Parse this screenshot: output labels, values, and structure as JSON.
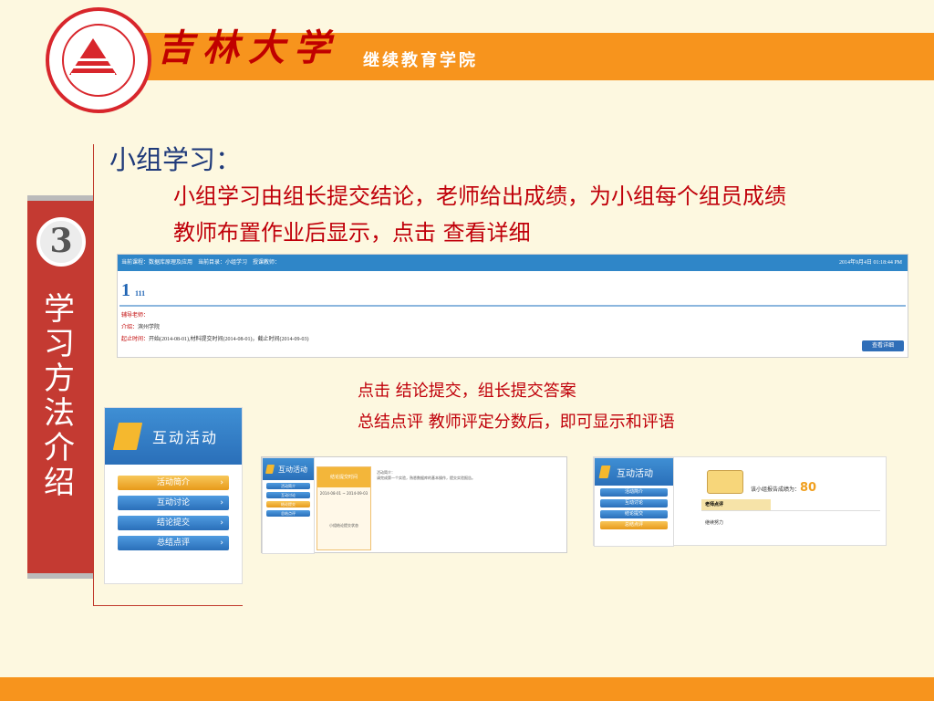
{
  "header": {
    "university": "吉林大学",
    "college": "继续教育学院"
  },
  "section": {
    "number": "3",
    "vertical_title": "学习方法介绍"
  },
  "content": {
    "title": "小组学习：",
    "desc_line1": "小组学习由组长提交结论，老师给出成绩，为小组每个组员成绩",
    "desc_line2": "教师布置作业后显示，点击 查看详细",
    "note_line1": "点击 结论提交，组长提交答案",
    "note_line2": "总结点评 教师评定分数后，即可显示和评语"
  },
  "screenshot_detail": {
    "breadcrumb": "当前课程：数据库原理及应用　当前目录：小组学习　授课教师：",
    "date": "2014年9月4日 01:18:44 PM",
    "title_num": "1",
    "title_sub": "111",
    "tutor_label": "辅导老师：",
    "intro_label": "介绍：",
    "intro_value": "滨州学院",
    "deadline_label": "起止时间：",
    "deadline_value": "开始(2014-08-01),材料提交时间(2014-08-01)，截止时间(2014-09-03)",
    "view_button": "查看详细"
  },
  "activity_panel": {
    "title": "互动活动",
    "items": [
      {
        "label": "活动简介",
        "active": true
      },
      {
        "label": "互动讨论",
        "active": false
      },
      {
        "label": "结论提交",
        "active": false
      },
      {
        "label": "总结点评",
        "active": false
      }
    ]
  },
  "screenshot_submit": {
    "panel_title": "互动活动",
    "items": [
      "活动简介",
      "互动讨论",
      "结论提交",
      "总结点评"
    ],
    "card_title": "结论提交时间",
    "card_text": "2014-08-01 ~ 2014-09-03",
    "card_note": "小组结论提交状态",
    "right_title": "活动简介：",
    "right_text": "请完成第一个实验，熟悉数据库的基本操作，提交实验报告。"
  },
  "screenshot_score": {
    "panel_title": "互动活动",
    "items": [
      "活动简介",
      "互动讨论",
      "结论提交",
      "总结点评"
    ],
    "score_label": "该小组报告成绩为：",
    "score_value": "80",
    "comment_title": "老师点评",
    "comment_text": "继续努力"
  },
  "colors": {
    "accent_orange": "#f7941d",
    "brand_red": "#c43a32",
    "text_red": "#c0000a",
    "title_blue": "#1f3a7a"
  }
}
